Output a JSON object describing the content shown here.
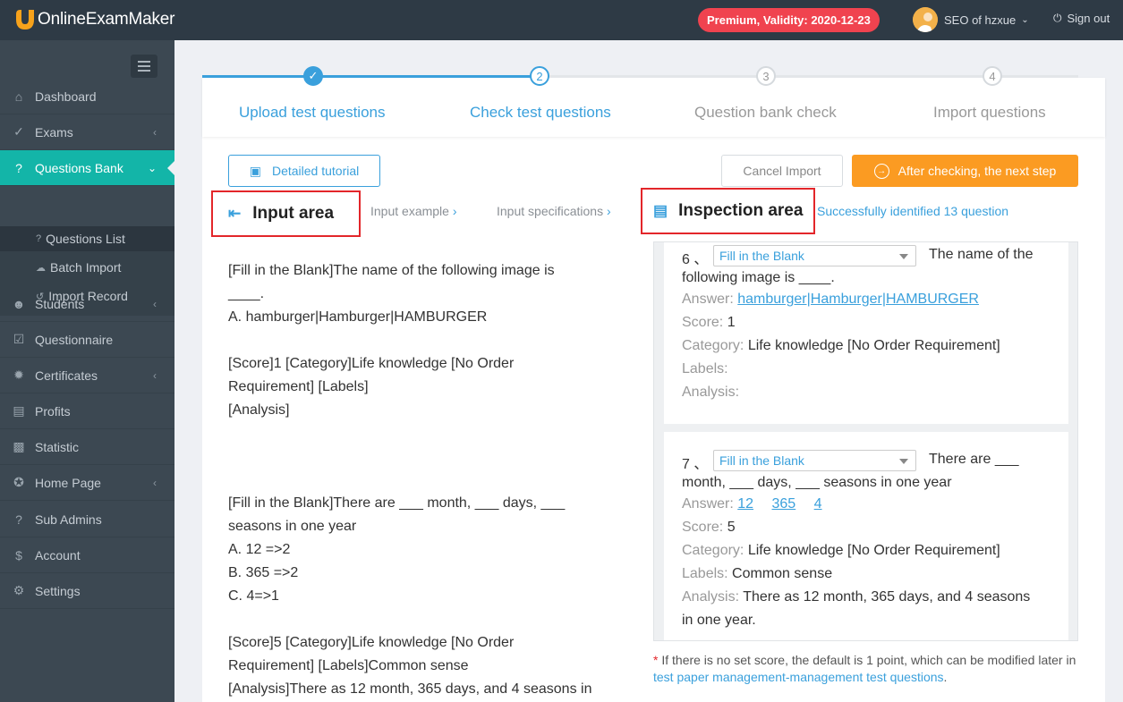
{
  "header": {
    "brand": "OnlineExamMaker",
    "premium": "Premium, Validity: 2020-12-23",
    "user": "SEO of hzxue",
    "signout": "Sign out"
  },
  "sidebar": {
    "items": [
      {
        "label": "Dashboard",
        "icon": "home-icon"
      },
      {
        "label": "Exams",
        "icon": "check-circle-icon"
      },
      {
        "label": "Questions Bank",
        "icon": "question-circle-icon"
      },
      {
        "label": "Students",
        "icon": "users-icon"
      },
      {
        "label": "Questionnaire",
        "icon": "checkbox-icon"
      },
      {
        "label": "Certificates",
        "icon": "gear-badge-icon"
      },
      {
        "label": "Profits",
        "icon": "card-icon"
      },
      {
        "label": "Statistic",
        "icon": "bar-chart-icon"
      },
      {
        "label": "Home Page",
        "icon": "puzzle-icon"
      },
      {
        "label": "Sub Admins",
        "icon": "question-icon"
      },
      {
        "label": "Account",
        "icon": "dollar-icon"
      },
      {
        "label": "Settings",
        "icon": "gear-icon"
      }
    ],
    "sub": [
      {
        "label": "Questions List"
      },
      {
        "label": "Batch Import"
      },
      {
        "label": "Import Record"
      }
    ]
  },
  "steps": [
    {
      "num": "1",
      "label": "Upload test questions",
      "state": "done"
    },
    {
      "num": "2",
      "label": "Check test questions",
      "state": "current"
    },
    {
      "num": "3",
      "label": "Question bank check",
      "state": "todo"
    },
    {
      "num": "4",
      "label": "Import questions",
      "state": "todo"
    }
  ],
  "toolbar": {
    "tutorial": "Detailed tutorial",
    "cancel": "Cancel Import",
    "next": "After checking, the next step"
  },
  "input_area": {
    "title": "Input area",
    "example": "Input example",
    "specs": "Input specifications",
    "lines": [
      "[Fill in the Blank]The name of the following image is",
      "____.",
      "A. hamburger|Hamburger|HAMBURGER",
      "",
      "[Score]1 [Category]Life knowledge [No Order",
      "Requirement] [Labels]",
      "[Analysis]",
      "",
      "",
      "",
      "[Fill in the Blank]There are ___ month, ___ days, ___",
      "seasons in one year",
      "A. 12 =>2",
      "B. 365 =>2",
      "C. 4=>1",
      "",
      "[Score]5 [Category]Life knowledge [No Order",
      "Requirement] [Labels]Common sense",
      "[Analysis]There as 12 month, 365 days, and 4 seasons in"
    ]
  },
  "inspection": {
    "title": "Inspection area",
    "success": "Successfully identified 13 question",
    "questions": [
      {
        "num": "6 、",
        "type": "Fill in the Blank",
        "text1": "The name of the",
        "text2": "following image is ____.",
        "answer_label": "Answer:",
        "answers": [
          "hamburger|Hamburger|HAMBURGER"
        ],
        "score_label": "Score:",
        "score": "1",
        "category_label": "Category:",
        "category": "Life knowledge  [No Order Requirement]",
        "labels_label": "Labels:",
        "labels": "",
        "analysis_label": "Analysis:",
        "analysis1": "",
        "analysis2": ""
      },
      {
        "num": "7 、",
        "type": "Fill in the Blank",
        "text1": "There are ___",
        "text2": "month, ___ days, ___ seasons in one year",
        "answer_label": "Answer:",
        "answers": [
          "12",
          "365",
          "4"
        ],
        "score_label": "Score:",
        "score": "5",
        "category_label": "Category:",
        "category": "Life knowledge  [No Order Requirement]",
        "labels_label": "Labels:",
        "labels": "Common sense",
        "analysis_label": "Analysis:",
        "analysis1": "There as 12 month, 365 days, and 4 seasons",
        "analysis2": "in one year."
      }
    ]
  },
  "note": {
    "star": "*",
    "text": " If there is no set score, the default is 1 point, which can be modified later in ",
    "link": "test paper management-management test questions",
    "end": "."
  },
  "colors": {
    "accent": "#13b5a8",
    "link": "#3aa0dc",
    "orange": "#fb9b22",
    "red": "#e3262a",
    "sidebar": "#3c4852",
    "topbar": "#2e3a45"
  }
}
